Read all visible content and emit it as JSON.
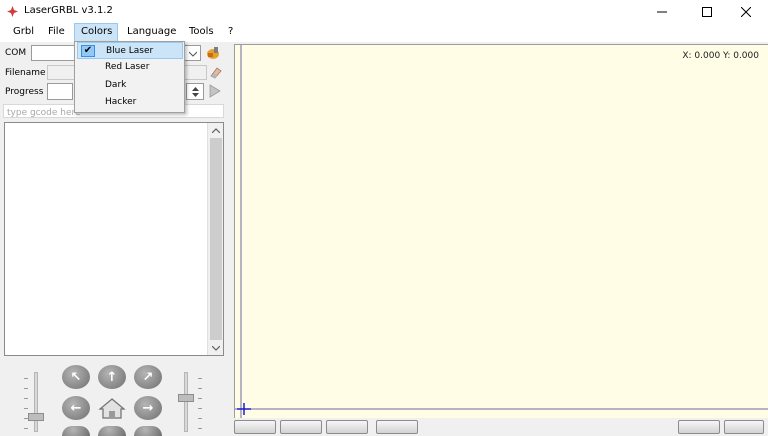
{
  "window": {
    "title": "LaserGRBL v3.1.2",
    "minimize_glyph": "—",
    "maximize_glyph": "☐",
    "close_glyph": "✕"
  },
  "menubar": {
    "items": [
      "Grbl",
      "File",
      "Colors",
      "Language",
      "Tools",
      "?"
    ]
  },
  "colors_menu": {
    "items": [
      {
        "label": "Blue Laser",
        "checked": true
      },
      {
        "label": "Red Laser",
        "checked": false
      },
      {
        "label": "Dark",
        "checked": false
      },
      {
        "label": "Hacker",
        "checked": false
      }
    ],
    "check_glyph": "✔"
  },
  "connection": {
    "com_label": "COM",
    "com_value": "",
    "filename_label": "Filename",
    "filename_value": "",
    "progress_label": "Progress"
  },
  "command": {
    "placeholder": "type gcode here"
  },
  "canvas": {
    "coords": "X: 0.000 Y: 0.000",
    "background": "#fffde6"
  },
  "icons": {
    "app": "laser-icon",
    "connect": "connect-plug-icon",
    "open_file": "eraser-icon",
    "run": "play-icon"
  }
}
